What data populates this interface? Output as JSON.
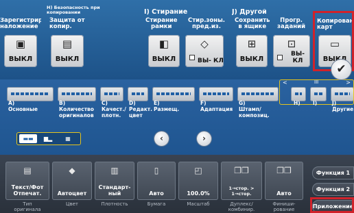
{
  "groups": {
    "g1": {
      "title": "Зарегистрир. наложение",
      "button_value": "ВЫКЛ"
    },
    "g_h": {
      "title": "H) Безопасность при копировании",
      "label": "Защита от\nкопир.",
      "button_value": "ВЫКЛ"
    },
    "g_i": {
      "title": "I) Стирание",
      "label1": "Стирание\nрамки",
      "button1_value": "ВЫКЛ",
      "label2": "Стир.зоны.\nпред.из.",
      "button2_value": "ВЫ-\nКЛ"
    },
    "g_j": {
      "title": "J) Другой",
      "label1": "Сохранить\nв ящике",
      "button1_value": "ВЫКЛ",
      "label2": "Прогр.\nзаданий",
      "button2_value": "ВЫ-\nКЛ"
    },
    "g_k": {
      "title": "Копирование карт",
      "button_value": "ВЫКЛ"
    }
  },
  "categories": [
    {
      "label": "A)\nОсновные"
    },
    {
      "label": "B)\nКоличество\nоригиналов"
    },
    {
      "label": "C)\nКачест./\nплотн."
    },
    {
      "label": "D)\nРедакт.\nцвет"
    },
    {
      "label": "E)\nРазмещ."
    },
    {
      "label": "F)\nАдаптация"
    },
    {
      "label": "G)\nШтамп/\nкомпозиц."
    },
    {
      "label": "H)"
    },
    {
      "label": "I)"
    },
    {
      "label": "J)\nДругие"
    }
  ],
  "scroll": {
    "left_arrow": "<",
    "right_arrow": ">",
    "thumb": "III"
  },
  "nav": {
    "prev": "‹",
    "next": "›",
    "ok": "✔"
  },
  "bottom": [
    {
      "value": "Текст/Фот\nОтпечат.",
      "label": "Тип\nоригинала",
      "icon": "document-icon"
    },
    {
      "value": "Автоцвет",
      "label": "Цвет",
      "icon": "color-icon"
    },
    {
      "value": "Стандарт-\nный",
      "label": "Плотность",
      "icon": "density-icon"
    },
    {
      "value": "Авто",
      "label": "Бумага",
      "icon": "paper-icon"
    },
    {
      "value": "100.0%",
      "label": "Масштаб",
      "icon": "zoom-icon"
    },
    {
      "value": "1→стор. >\n1→стор.",
      "label": "Дуплекс/\nкомбинир.",
      "icon": "duplex-icon"
    },
    {
      "value": "Авто",
      "label": "Финиши-\nрование",
      "icon": "finishing-icon"
    }
  ],
  "function_tabs": {
    "f1": "Функция 1",
    "f2": "Функция 2",
    "app": "Приложение"
  },
  "colors": {
    "highlight": "#d1222a",
    "accent": "#e6c51e",
    "background": "#2a62a0"
  }
}
